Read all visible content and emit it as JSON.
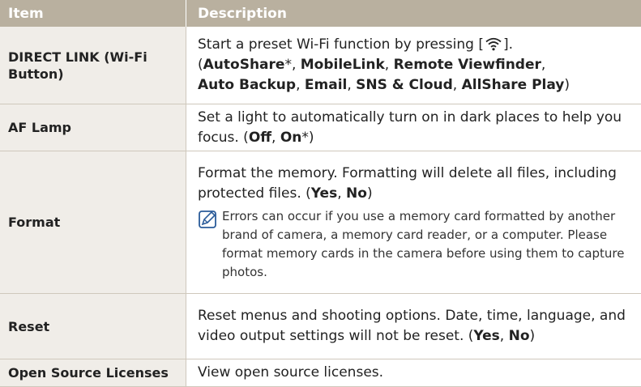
{
  "header": {
    "item": "Item",
    "description": "Description"
  },
  "rows": [
    {
      "item": "DIRECT LINK (Wi-Fi Button)",
      "desc_pre": "Start a preset Wi-Fi function by pressing [",
      "desc_post": "].",
      "open_paren": "(",
      "options": [
        "AutoShare",
        "*, ",
        "MobileLink",
        ", ",
        "Remote Viewfinder",
        ",",
        "Auto Backup",
        ", ",
        "Email",
        ", ",
        "SNS & Cloud",
        ", ",
        "AllShare Play",
        ")"
      ]
    },
    {
      "item": "AF Lamp",
      "desc": "Set a light to automatically turn on in dark places to help you focus. (",
      "opt1": "Off",
      "sep": ", ",
      "opt2": "On",
      "end": "*)"
    },
    {
      "item": "Format",
      "desc": "Format the memory. Formatting will delete all files, including protected files. (",
      "opt1": "Yes",
      "sep": ", ",
      "opt2": "No",
      "end": ")",
      "note": "Errors can occur if you use a memory card formatted by another brand of camera, a memory card reader, or a computer. Please format memory cards in the camera before using them to capture photos."
    },
    {
      "item": "Reset",
      "desc": "Reset menus and shooting options. Date, time, language, and video output settings will not be reset. (",
      "opt1": "Yes",
      "sep": ", ",
      "opt2": "No",
      "end": ")"
    },
    {
      "item": "Open Source Licenses",
      "desc": "View open source licenses."
    }
  ],
  "colors": {
    "header_bg": "#b9b09f",
    "item_bg": "#f0ede8",
    "border": "#cfc8bc"
  },
  "icons": [
    "wifi-icon",
    "note-pencil-icon"
  ]
}
